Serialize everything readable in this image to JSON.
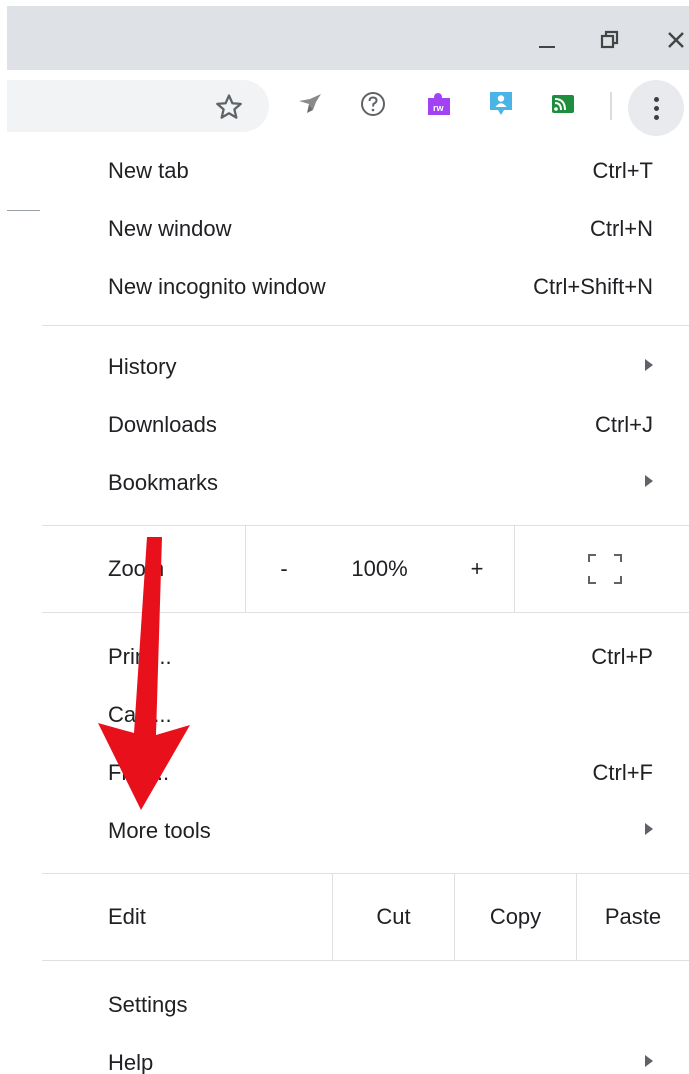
{
  "window": {
    "minimize_icon": "minimize-icon",
    "restore_icon": "restore-icon",
    "close_icon": "close-icon"
  },
  "toolbar": {
    "bookmark_icon": "star-icon",
    "extensions": [
      "dove-extension-icon",
      "help-circle-extension-icon",
      "rw-puzzle-extension-icon",
      "user-badge-extension-icon",
      "cast-extension-icon"
    ],
    "menu_icon": "vertical-dots-icon"
  },
  "menu": {
    "group1": [
      {
        "label": "New tab",
        "shortcut": "Ctrl+T"
      },
      {
        "label": "New window",
        "shortcut": "Ctrl+N"
      },
      {
        "label": "New incognito window",
        "shortcut": "Ctrl+Shift+N"
      }
    ],
    "group2": [
      {
        "label": "History"
      },
      {
        "label": "Downloads",
        "shortcut": "Ctrl+J"
      },
      {
        "label": "Bookmarks"
      }
    ],
    "zoom": {
      "label": "Zoom",
      "minus": "-",
      "level": "100%",
      "plus": "+"
    },
    "group3": [
      {
        "label": "Print...",
        "shortcut": "Ctrl+P"
      },
      {
        "label": "Cast..."
      },
      {
        "label": "Find...",
        "shortcut": "Ctrl+F"
      },
      {
        "label": "More tools"
      }
    ],
    "edit": {
      "label": "Edit",
      "cut": "Cut",
      "copy": "Copy",
      "paste": "Paste"
    },
    "group4": [
      {
        "label": "Settings"
      },
      {
        "label": "Help"
      }
    ]
  },
  "colors": {
    "titlebar": "#dee1e6",
    "annotation_arrow": "#e8101a",
    "accent_purple": "#a142f4",
    "accent_blue": "#4ab4e6",
    "accent_green": "#1e8e3e"
  }
}
